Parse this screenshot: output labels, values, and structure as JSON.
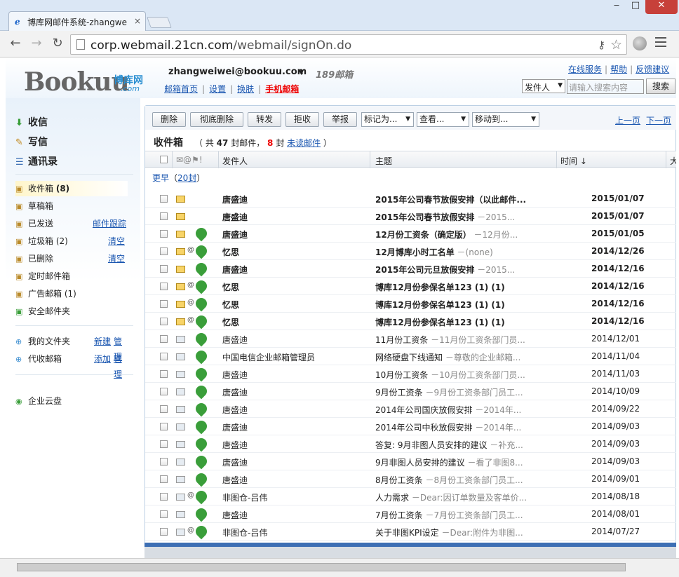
{
  "browser": {
    "tab_title": "博库网邮件系统-zhangwe",
    "tab_close": "×",
    "url_host": "corp.webmail.21cn.com",
    "url_path": "/webmail/signOn.do",
    "win_min": "‒",
    "win_max": "□",
    "win_close": "✕",
    "back": "←",
    "forward": "→",
    "reload": "↻",
    "key_glyph": "⚷",
    "star_glyph": "☆"
  },
  "header": {
    "logo_text": "Bookuu",
    "logo_cn": "博库网",
    "logo_com": ".com",
    "user_email": "zhangweiwei@bookuu.com",
    "mail189": "189邮箱",
    "links": [
      "邮箱首页",
      "设置",
      "换肤",
      "手机邮箱"
    ],
    "service_links": [
      "在线服务",
      "帮助",
      "反馈建议"
    ],
    "search_type": "发件人",
    "search_placeholder": "请输入搜索内容",
    "search_button": "搜索"
  },
  "sidebar": {
    "main_nav": [
      "收信",
      "写信",
      "通讯录"
    ],
    "folders": [
      {
        "name": "收件箱",
        "count": "(8)",
        "active": true
      },
      {
        "name": "草稿箱"
      },
      {
        "name": "已发送",
        "link1": "邮件跟踪"
      },
      {
        "name": "垃圾箱",
        "count": "(2)",
        "link1": "清空"
      },
      {
        "name": "已删除",
        "link1": "清空"
      },
      {
        "name": "定时邮件箱"
      },
      {
        "name": "广告邮箱",
        "count": "(1)"
      },
      {
        "name": "安全邮件夹"
      }
    ],
    "my_folders": {
      "name": "我的文件夹",
      "link1": "新建",
      "link2": "管理"
    },
    "proxy": {
      "name": "代收邮箱",
      "link1": "添加",
      "link2": "管理"
    },
    "cloud": "企业云盘"
  },
  "actions": {
    "buttons": [
      "删除",
      "彻底删除",
      "转发",
      "拒收",
      "举报"
    ],
    "dropdowns": [
      "标记为...",
      "查看...",
      "移动到..."
    ],
    "prev_page": "上一页",
    "next_page": "下一页"
  },
  "inbox": {
    "title": "收件箱",
    "meta_prefix": "（ 共",
    "total": "47",
    "meta_mid": "封邮件，",
    "unread": "8",
    "meta_unit": "封",
    "unread_link": "未读邮件",
    "meta_end": "）",
    "columns": {
      "sender": "发件人",
      "subject": "主题",
      "time": "时间 ↓",
      "size": "大"
    },
    "group_label": "更早",
    "group_count": "20封"
  },
  "emails": [
    {
      "sender": "唐盛迪",
      "subject": "2015年公司春节放假安排（以此邮件...",
      "preview": "",
      "time": "2015/01/07",
      "unread": true,
      "at": false,
      "badge": false
    },
    {
      "sender": "唐盛迪",
      "subject": "2015年公司春节放假安排",
      "preview": "－2015...",
      "time": "2015/01/07",
      "unread": true,
      "at": false,
      "badge": false
    },
    {
      "sender": "唐盛迪",
      "subject": "12月份工资条（确定版）",
      "preview": "－12月份...",
      "time": "2015/01/05",
      "unread": true,
      "at": false,
      "badge": true
    },
    {
      "sender": "忆思",
      "subject": "12月博库小时工名单",
      "preview": "－(none)",
      "time": "2014/12/26",
      "unread": true,
      "at": true,
      "badge": true
    },
    {
      "sender": "唐盛迪",
      "subject": "2015年公司元旦放假安排",
      "preview": "－2015...",
      "time": "2014/12/16",
      "unread": true,
      "at": false,
      "badge": true
    },
    {
      "sender": "忆思",
      "subject": "博库12月份参保名单123 (1) (1)",
      "preview": "",
      "time": "2014/12/16",
      "unread": true,
      "at": true,
      "badge": true
    },
    {
      "sender": "忆思",
      "subject": "博库12月份参保名单123 (1) (1)",
      "preview": "",
      "time": "2014/12/16",
      "unread": true,
      "at": true,
      "badge": true
    },
    {
      "sender": "忆思",
      "subject": "博库12月份参保名单123 (1) (1)",
      "preview": "",
      "time": "2014/12/16",
      "unread": true,
      "at": true,
      "badge": true
    },
    {
      "sender": "唐盛迪",
      "subject": "11月份工资条",
      "preview": "－11月份工资条部门员...",
      "time": "2014/12/01",
      "unread": false,
      "at": false,
      "badge": true
    },
    {
      "sender": "中国电信企业邮箱管理员",
      "subject": "网络硬盘下线通知",
      "preview": "－尊敬的企业邮箱...",
      "time": "2014/11/04",
      "unread": false,
      "at": false,
      "badge": true
    },
    {
      "sender": "唐盛迪",
      "subject": "10月份工资条",
      "preview": "－10月份工资条部门员...",
      "time": "2014/11/03",
      "unread": false,
      "at": false,
      "badge": true
    },
    {
      "sender": "唐盛迪",
      "subject": "9月份工资条",
      "preview": "－9月份工资条部门员工...",
      "time": "2014/10/09",
      "unread": false,
      "at": false,
      "badge": true
    },
    {
      "sender": "唐盛迪",
      "subject": "2014年公司国庆放假安排",
      "preview": "－2014年...",
      "time": "2014/09/22",
      "unread": false,
      "at": false,
      "badge": true
    },
    {
      "sender": "唐盛迪",
      "subject": "2014年公司中秋放假安排",
      "preview": "－2014年...",
      "time": "2014/09/03",
      "unread": false,
      "at": false,
      "badge": true
    },
    {
      "sender": "唐盛迪",
      "subject": "答复: 9月非图人员安排的建议",
      "preview": "－补充...",
      "time": "2014/09/03",
      "unread": false,
      "at": false,
      "badge": true
    },
    {
      "sender": "唐盛迪",
      "subject": "9月非图人员安排的建议",
      "preview": "－看了非图8...",
      "time": "2014/09/03",
      "unread": false,
      "at": false,
      "badge": true
    },
    {
      "sender": "唐盛迪",
      "subject": "8月份工资条",
      "preview": "－8月份工资条部门员工...",
      "time": "2014/09/01",
      "unread": false,
      "at": false,
      "badge": true
    },
    {
      "sender": "非图仓-吕伟",
      "subject": "人力需求",
      "preview": "－Dear:因订单数量及客单价...",
      "time": "2014/08/18",
      "unread": false,
      "at": true,
      "badge": true
    },
    {
      "sender": "唐盛迪",
      "subject": "7月份工资条",
      "preview": "－7月份工资条部门员工...",
      "time": "2014/08/01",
      "unread": false,
      "at": false,
      "badge": true
    },
    {
      "sender": "非图仓-吕伟",
      "subject": "关于非图KPI设定",
      "preview": "－Dear:附件为非图...",
      "time": "2014/07/27",
      "unread": false,
      "at": true,
      "badge": true
    }
  ]
}
